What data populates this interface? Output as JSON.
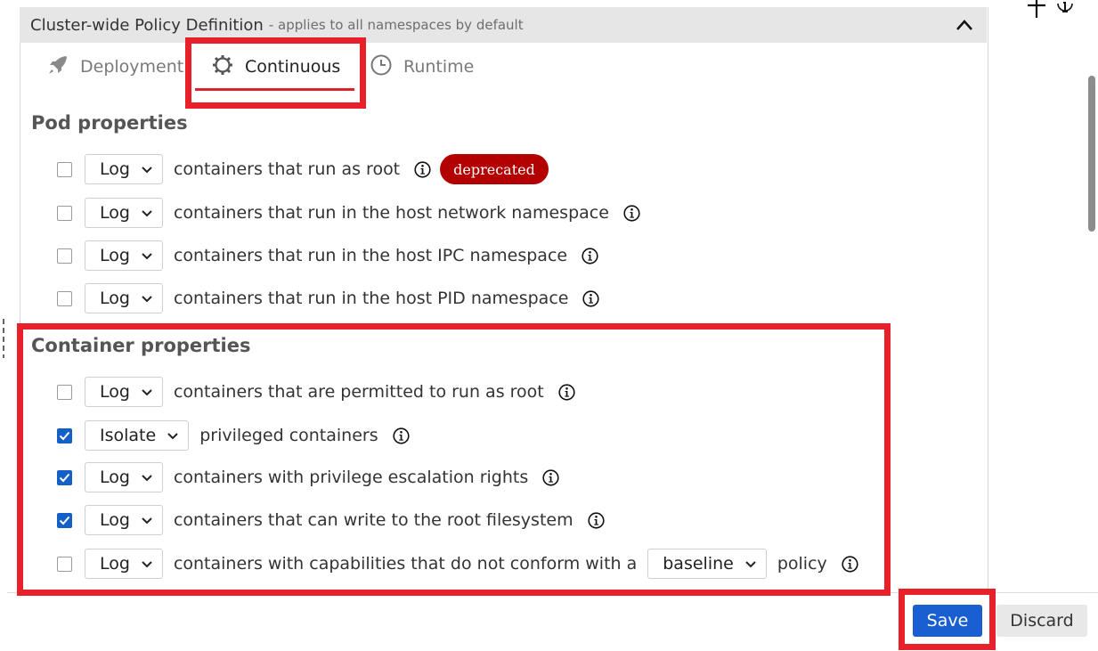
{
  "panel": {
    "title": "Cluster-wide Policy Definition",
    "subtitle": "- applies to all namespaces by default"
  },
  "tabs": [
    {
      "label": "Deployment",
      "icon": "rocket-icon"
    },
    {
      "label": "Continuous",
      "icon": "gear-icon",
      "active": true
    },
    {
      "label": "Runtime",
      "icon": "clock-icon"
    }
  ],
  "pod_section": {
    "title": "Pod properties",
    "rows": [
      {
        "checked": false,
        "action": "Log",
        "text": "containers that run as root",
        "badge": "deprecated"
      },
      {
        "checked": false,
        "action": "Log",
        "text": "containers that run in the host network namespace"
      },
      {
        "checked": false,
        "action": "Log",
        "text": "containers that run in the host IPC namespace"
      },
      {
        "checked": false,
        "action": "Log",
        "text": "containers that run in the host PID namespace"
      }
    ]
  },
  "container_section": {
    "title": "Container properties",
    "rows": [
      {
        "checked": false,
        "action": "Log",
        "text": "containers that are permitted to run as root"
      },
      {
        "checked": true,
        "action": "Isolate",
        "text": "privileged containers"
      },
      {
        "checked": true,
        "action": "Log",
        "text": "containers with privilege escalation rights"
      },
      {
        "checked": true,
        "action": "Log",
        "text": "containers that can write to the root filesystem"
      },
      {
        "checked": false,
        "action": "Log",
        "text": "containers with capabilities that do not conform with a",
        "policy_select": "baseline",
        "text_after": "policy"
      }
    ]
  },
  "footer": {
    "save_label": "Save",
    "discard_label": "Discard"
  },
  "colors": {
    "accent_blue": "#1a5fd1",
    "highlight_red": "#e8202a",
    "badge_red": "#b30000"
  }
}
